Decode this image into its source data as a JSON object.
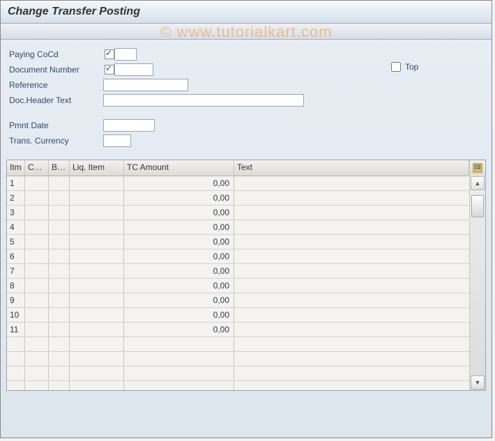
{
  "header": {
    "title": "Change Transfer Posting"
  },
  "watermark": "© www.tutorialkart.com",
  "form": {
    "paying_cocd": {
      "label": "Paying CoCd",
      "value": "",
      "required": true
    },
    "doc_number": {
      "label": "Document Number",
      "value": "",
      "required": true
    },
    "reference": {
      "label": "Reference",
      "value": ""
    },
    "header_text": {
      "label": "Doc.Header Text",
      "value": ""
    },
    "pmnt_date": {
      "label": "Pmnt Date",
      "value": ""
    },
    "trans_currency": {
      "label": "Trans. Currency",
      "value": ""
    },
    "top": {
      "label": "Top",
      "checked": false
    }
  },
  "grid": {
    "columns": {
      "itm": "Itm",
      "cocd": "CoCd",
      "bu": "Bu...",
      "liq": "Liq. Item",
      "tc": "TC Amount",
      "text": "Text"
    },
    "rows": [
      {
        "itm": "1",
        "cocd": "",
        "bu": "",
        "liq": "",
        "tc": "0,00",
        "text": ""
      },
      {
        "itm": "2",
        "cocd": "",
        "bu": "",
        "liq": "",
        "tc": "0,00",
        "text": ""
      },
      {
        "itm": "3",
        "cocd": "",
        "bu": "",
        "liq": "",
        "tc": "0,00",
        "text": ""
      },
      {
        "itm": "4",
        "cocd": "",
        "bu": "",
        "liq": "",
        "tc": "0,00",
        "text": ""
      },
      {
        "itm": "5",
        "cocd": "",
        "bu": "",
        "liq": "",
        "tc": "0,00",
        "text": ""
      },
      {
        "itm": "6",
        "cocd": "",
        "bu": "",
        "liq": "",
        "tc": "0,00",
        "text": ""
      },
      {
        "itm": "7",
        "cocd": "",
        "bu": "",
        "liq": "",
        "tc": "0,00",
        "text": ""
      },
      {
        "itm": "8",
        "cocd": "",
        "bu": "",
        "liq": "",
        "tc": "0,00",
        "text": ""
      },
      {
        "itm": "9",
        "cocd": "",
        "bu": "",
        "liq": "",
        "tc": "0,00",
        "text": ""
      },
      {
        "itm": "10",
        "cocd": "",
        "bu": "",
        "liq": "",
        "tc": "0,00",
        "text": ""
      },
      {
        "itm": "11",
        "cocd": "",
        "bu": "",
        "liq": "",
        "tc": "0,00",
        "text": ""
      },
      {
        "itm": "",
        "cocd": "",
        "bu": "",
        "liq": "",
        "tc": "",
        "text": ""
      },
      {
        "itm": "",
        "cocd": "",
        "bu": "",
        "liq": "",
        "tc": "",
        "text": ""
      },
      {
        "itm": "",
        "cocd": "",
        "bu": "",
        "liq": "",
        "tc": "",
        "text": ""
      },
      {
        "itm": "",
        "cocd": "",
        "bu": "",
        "liq": "",
        "tc": "",
        "text": ""
      }
    ]
  }
}
